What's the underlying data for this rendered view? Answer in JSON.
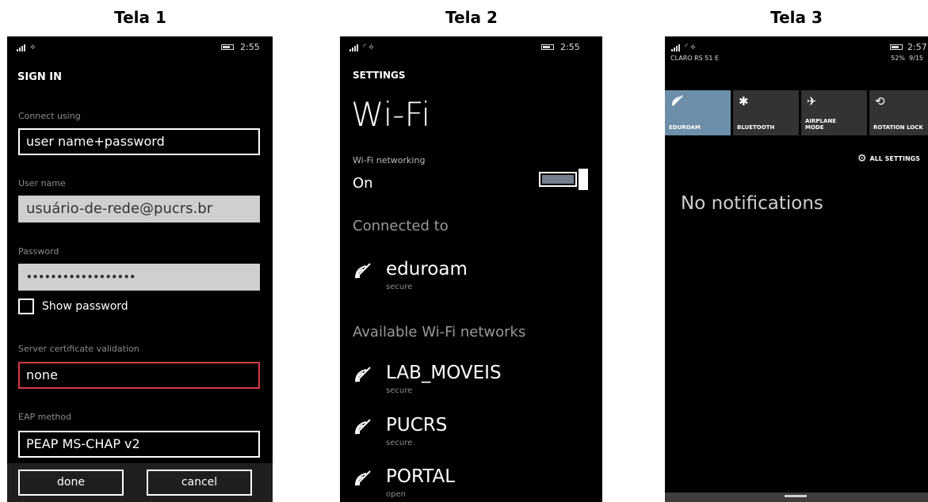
{
  "captions": [
    "Tela 1",
    "Tela 2",
    "Tela 3"
  ],
  "screen1": {
    "time": "2:55",
    "title": "SIGN IN",
    "connect_label": "Connect using",
    "connect_value": "user name+password",
    "username_label": "User name",
    "username_value": "usuário-de-rede@pucrs.br",
    "password_label": "Password",
    "password_value": "••••••••••••••••••",
    "show_password_label": "Show password",
    "cert_label": "Server certificate validation",
    "cert_value": "none",
    "eap_label": "EAP method",
    "eap_value": "PEAP MS-CHAP v2",
    "done_label": "done",
    "cancel_label": "cancel"
  },
  "screen2": {
    "time": "2:55",
    "settings_label": "SETTINGS",
    "page_title": "Wi-Fi",
    "networking_label": "Wi-Fi networking",
    "networking_state": "On",
    "connected_heading": "Connected to",
    "available_heading": "Available Wi-Fi networks",
    "connected_network": {
      "name": "eduroam",
      "state": "secure"
    },
    "networks": [
      {
        "name": "LAB_MOVEIS",
        "state": "secure"
      },
      {
        "name": "PUCRS",
        "state": "secure"
      },
      {
        "name": "PORTAL",
        "state": "open"
      }
    ]
  },
  "screen3": {
    "time": "2:57",
    "carrier": "CLARO RS 51 E",
    "battery_percent": "52%",
    "date": "9/15",
    "tiles": [
      {
        "label": "EDUROAM",
        "icon": "wifi-icon",
        "active": true
      },
      {
        "label": "BLUETOOTH",
        "icon": "bluetooth-icon",
        "active": false
      },
      {
        "label": "AIRPLANE\nMODE",
        "icon": "airplane-icon",
        "active": false
      },
      {
        "label": "ROTATION LOCK",
        "icon": "rotation-lock-icon",
        "active": false
      }
    ],
    "all_settings_label": "ALL SETTINGS",
    "no_notifications": "No notifications"
  }
}
